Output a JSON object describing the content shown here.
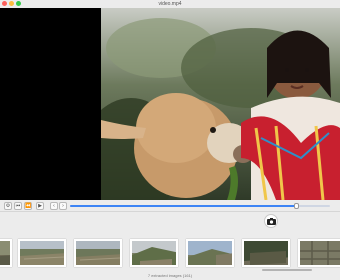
{
  "window": {
    "title": "video.mp4"
  },
  "controls": {
    "settings_icon": "gear-icon",
    "rewind_icon": "skip-back-icon",
    "fast_rewind_icon": "rewind-icon",
    "play_icon": "play-icon",
    "prev_frame_icon": "chevron-left-icon",
    "next_frame_icon": "chevron-right-icon",
    "playback_progress": 0.87
  },
  "capture": {
    "icon": "camera-icon"
  },
  "thumbnails": [
    {
      "kind": "ruins-partial"
    },
    {
      "kind": "ruins"
    },
    {
      "kind": "ruins"
    },
    {
      "kind": "ruins",
      "selected": true
    },
    {
      "kind": "ruins-sky"
    },
    {
      "kind": "ruins-dark"
    },
    {
      "kind": "ruins-partial"
    }
  ],
  "status": {
    "text": "7 extracted images (161)"
  },
  "colors": {
    "accent": "#3d84f5",
    "background": "#ececec"
  }
}
